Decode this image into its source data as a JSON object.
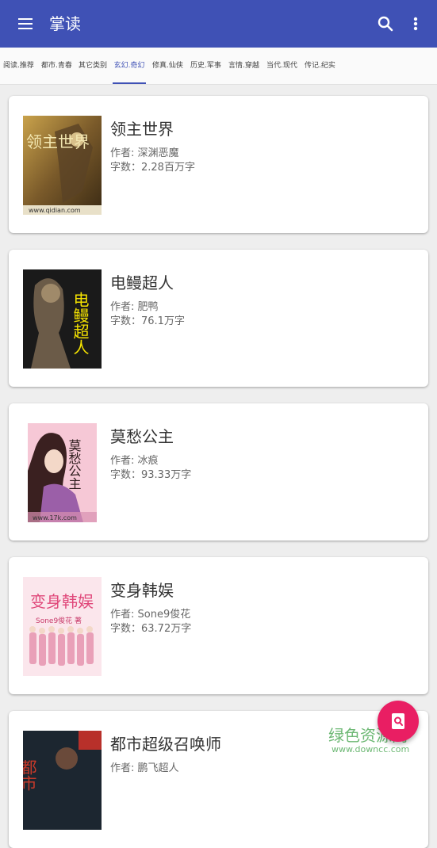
{
  "appbar": {
    "title": "掌读",
    "menu_icon": "menu-icon",
    "search_icon": "search-icon",
    "more_icon": "more-vert-icon",
    "color": "#3f51b5"
  },
  "tabs": [
    {
      "label": "阅读.推荐"
    },
    {
      "label": "都市.青春"
    },
    {
      "label": "其它类别"
    },
    {
      "label": "玄幻.奇幻",
      "active": true
    },
    {
      "label": "修真.仙侠"
    },
    {
      "label": "历史.军事"
    },
    {
      "label": "言情.穿越"
    },
    {
      "label": "当代.现代"
    },
    {
      "label": "传记.纪实"
    }
  ],
  "books": [
    {
      "title": "领主世界",
      "author": "作者: 深渊恶魔",
      "words": "字数：2.28百万字",
      "cover_text": "领主世界",
      "cover_sub": "www.qidian.com"
    },
    {
      "title": "电鳗超人",
      "author": "作者: 肥鸭",
      "words": "字数：76.1万字",
      "cover_text": "电鳗超人",
      "cover_sub": ""
    },
    {
      "title": "莫愁公主",
      "author": "作者: 冰痕",
      "words": "字数：93.33万字",
      "cover_text": "莫愁公主",
      "cover_sub": "www.17k.com"
    },
    {
      "title": "变身韩娱",
      "author": "作者: Sone9俊花",
      "words": "字数：63.72万字",
      "cover_text": "变身韩娱",
      "cover_sub": "Sone9俊花 著"
    },
    {
      "title": "都市超级召唤师",
      "author": "作者: 鹏飞超人",
      "words": "",
      "cover_text": "都市",
      "cover_sub": ""
    }
  ],
  "fab": {
    "icon": "search-book-icon",
    "color": "#e91e63"
  },
  "watermark": {
    "main": "绿色资源网",
    "sub": "www.downcc.com"
  }
}
